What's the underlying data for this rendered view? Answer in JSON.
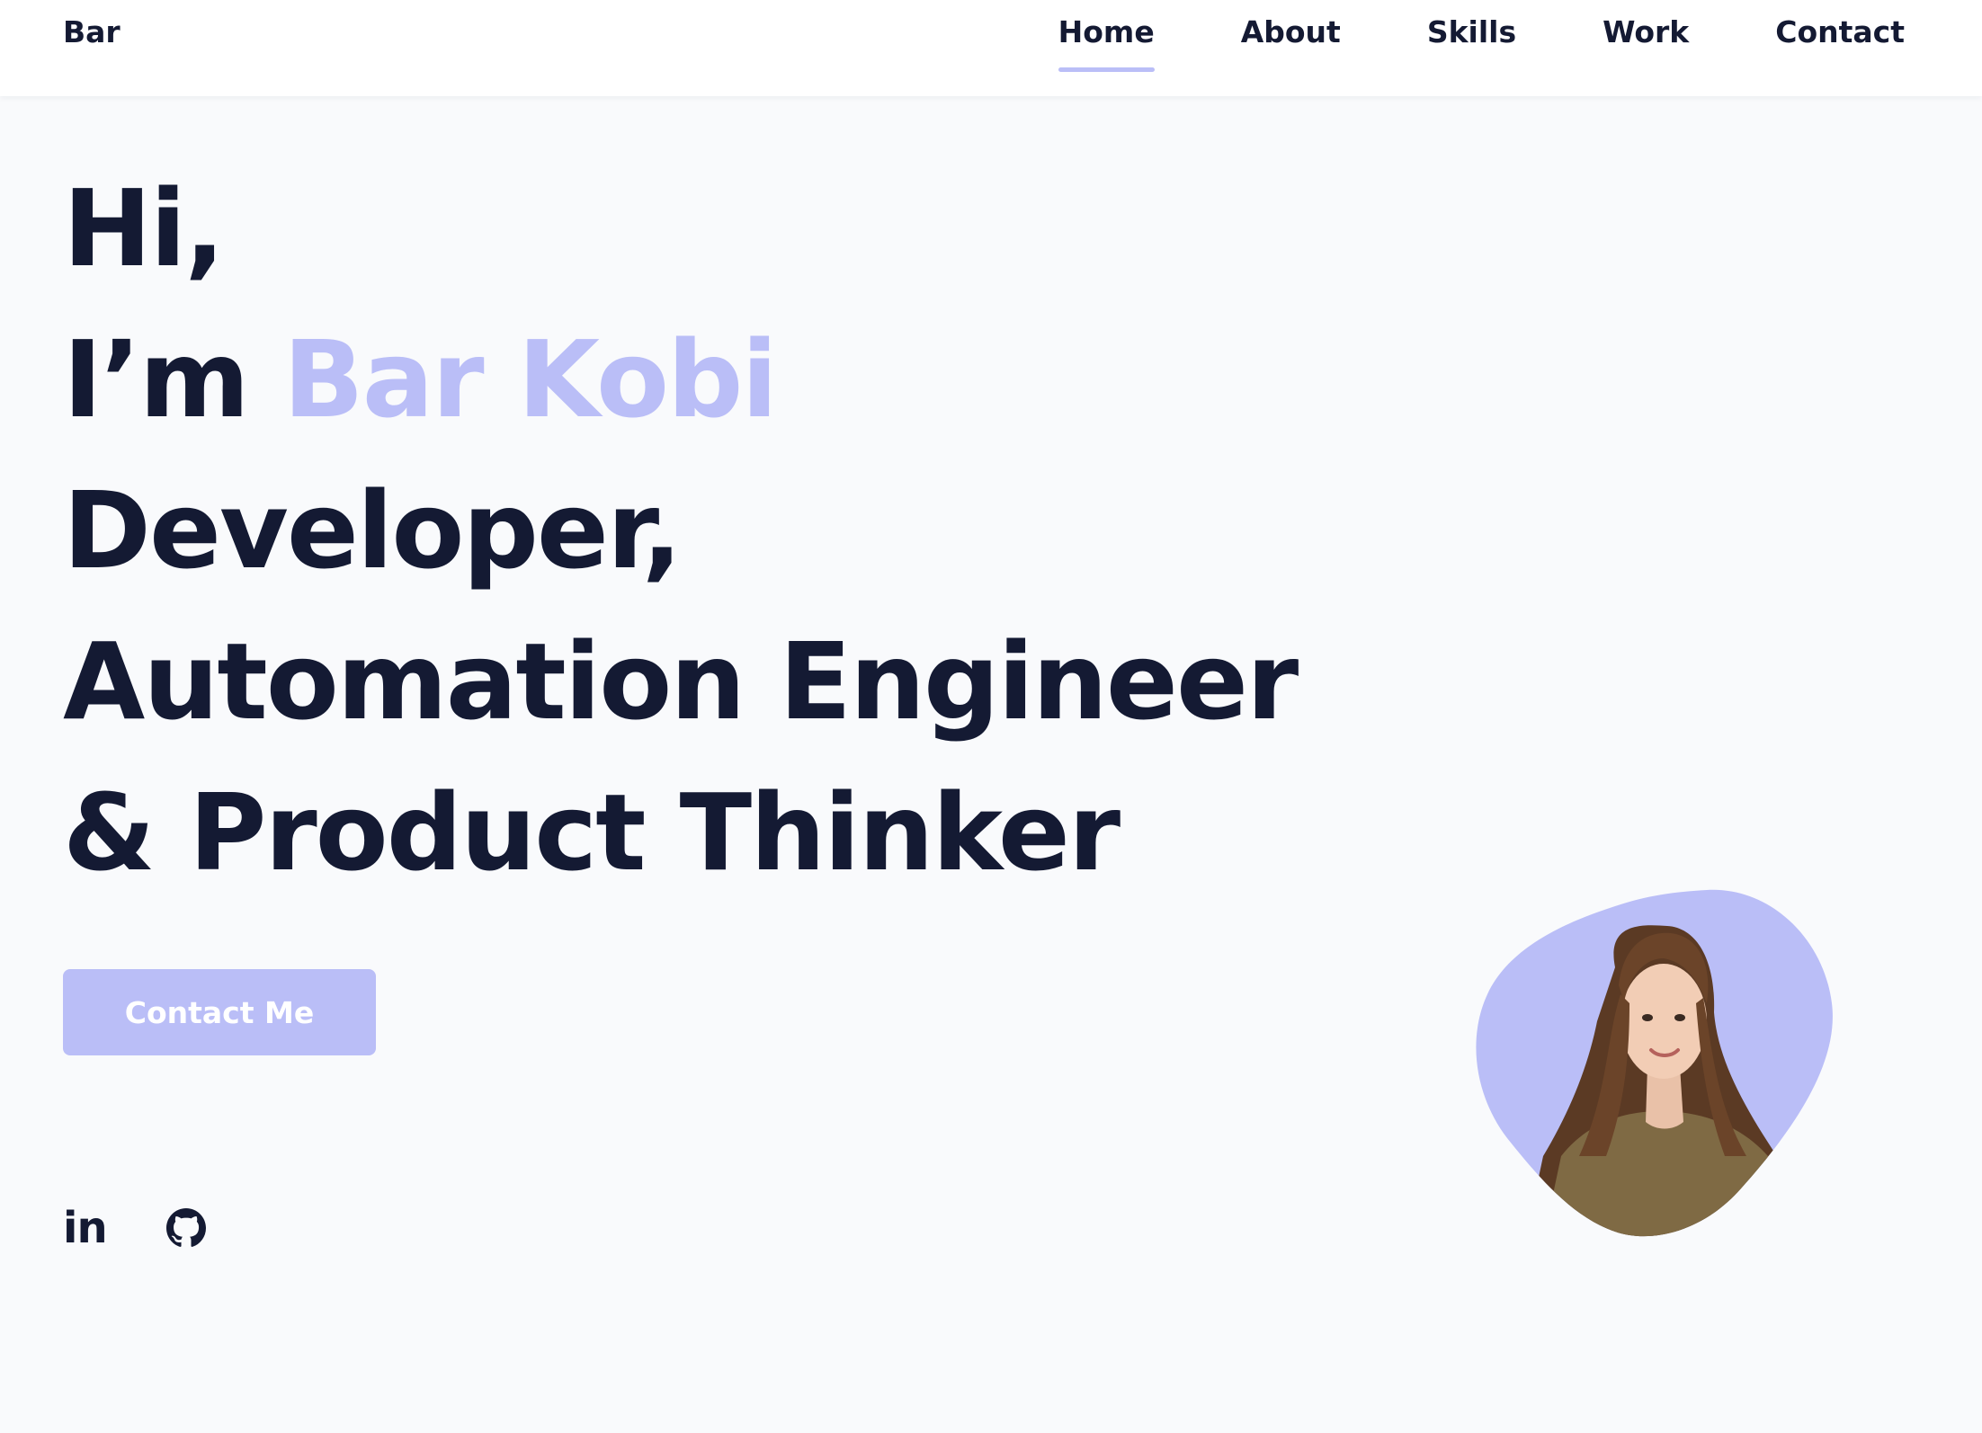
{
  "header": {
    "logo": "Bar",
    "nav": [
      {
        "label": "Home",
        "active": true
      },
      {
        "label": "About",
        "active": false
      },
      {
        "label": "Skills",
        "active": false
      },
      {
        "label": "Work",
        "active": false
      },
      {
        "label": "Contact",
        "active": false
      }
    ]
  },
  "hero": {
    "greeting": "Hi,",
    "intro": "I’m",
    "name": "Bar Kobi",
    "role_line_1": "Developer,",
    "role_line_2": "Automation Engineer",
    "role_line_3": "& Product Thinker"
  },
  "cta": {
    "label": "Contact Me"
  },
  "social": {
    "linkedin_text": "in",
    "icons": [
      "linkedin-icon",
      "github-icon"
    ]
  },
  "portrait": {
    "icon": "profile-photo"
  },
  "colors": {
    "accent": "#babef7",
    "text": "#141a33",
    "background": "#f9fafc",
    "header": "#ffffff"
  }
}
